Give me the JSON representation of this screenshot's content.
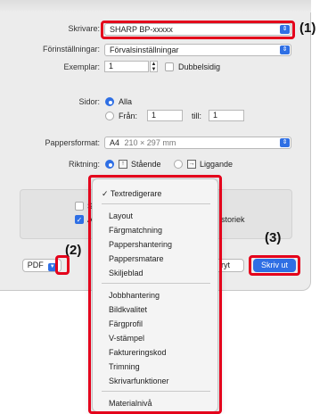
{
  "printer": {
    "label": "Skrivare:",
    "value": "SHARP BP-xxxxx"
  },
  "presets": {
    "label": "Förinställningar:",
    "value": "Förvalsinställningar"
  },
  "copies": {
    "label": "Exemplar:",
    "value": "1",
    "duplex_label": "Dubbelsidig",
    "duplex_checked": false
  },
  "pages": {
    "label": "Sidor:",
    "all_label": "Alla",
    "from_label": "Från:",
    "from_value": "1",
    "to_label": "till:",
    "to_value": "1",
    "selected": "all"
  },
  "paper": {
    "label": "Pappersformat:",
    "value": "A4",
    "size_text": "210 × 297 mm"
  },
  "orientation": {
    "label": "Riktning:",
    "portrait_label": "Stående",
    "landscape_label": "Liggande",
    "selected": "portrait"
  },
  "lower": {
    "check1_text": "S",
    "check2_text": "A",
    "history_text": "storiek",
    "copy_text": "ryt"
  },
  "buttons": {
    "pdf": "PDF",
    "print": "Skriv ut"
  },
  "callouts": {
    "c1": "(1)",
    "c2": "(2)",
    "c3": "(3)"
  },
  "menu": {
    "checked_item": "Textredigerare",
    "group1": [
      "Layout",
      "Färgmatchning",
      "Pappershantering",
      "Pappersmatare",
      "Skiljeblad"
    ],
    "group2": [
      "Jobbhantering",
      "Bildkvalitet",
      "Färgprofil",
      "V-stämpel",
      "Faktureringskod",
      "Trimning",
      "Skrivarfunktioner"
    ],
    "group3": [
      "Materialnivå"
    ]
  },
  "colors": {
    "highlight": "#e4001b",
    "accent": "#2f6fe4"
  }
}
